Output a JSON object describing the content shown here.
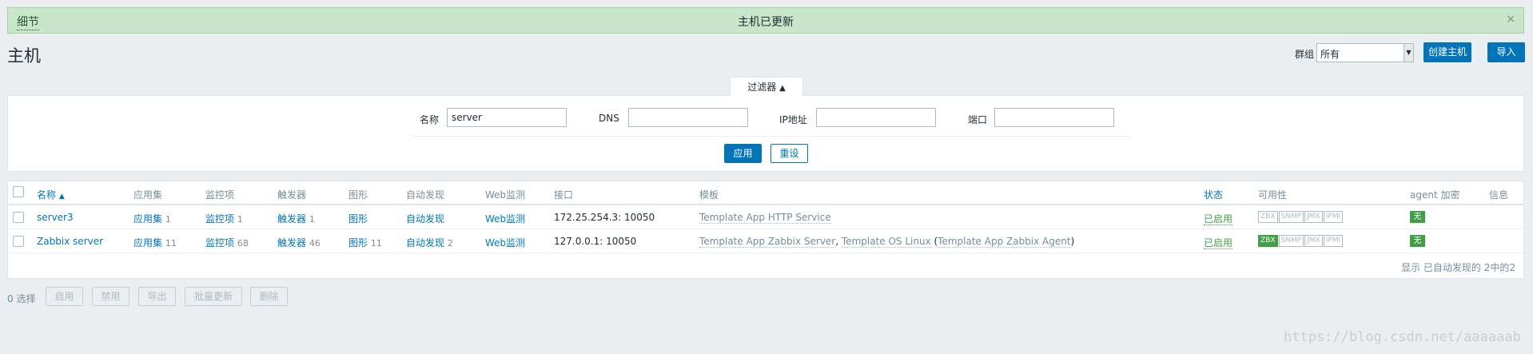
{
  "message": {
    "details": "细节",
    "text": "主机已更新",
    "close": "×"
  },
  "header": {
    "title": "主机",
    "group_label": "群组",
    "group_value": "所有",
    "create_button": "创建主机",
    "import_button": "导入"
  },
  "filter": {
    "tab_label": "过滤器",
    "tab_arrow": "▲",
    "name_label": "名称",
    "name_value": "server",
    "dns_label": "DNS",
    "dns_value": "",
    "ip_label": "IP地址",
    "ip_value": "",
    "port_label": "端口",
    "port_value": "",
    "apply": "应用",
    "reset": "重设"
  },
  "table": {
    "columns": {
      "name": "名称",
      "sort_arrow": "▲",
      "apps": "应用集",
      "items": "监控项",
      "triggers": "触发器",
      "graphs": "图形",
      "discovery": "自动发现",
      "web": "Web监测",
      "interface": "接口",
      "templates": "模板",
      "status": "状态",
      "availability": "可用性",
      "encryption": "agent 加密",
      "info": "信息"
    },
    "rows": [
      {
        "name": "server3",
        "apps": "应用集",
        "apps_count": "1",
        "items": "监控项",
        "items_count": "1",
        "triggers": "触发器",
        "triggers_count": "1",
        "graphs": "图形",
        "graphs_count": "",
        "discovery": "自动发现",
        "discovery_count": "",
        "web": "Web监测",
        "interface": "172.25.254.3: 10050",
        "template1": "Template App HTTP Service",
        "status": "已启用",
        "encryption": "无"
      },
      {
        "name": "Zabbix server",
        "apps": "应用集",
        "apps_count": "11",
        "items": "监控项",
        "items_count": "68",
        "triggers": "触发器",
        "triggers_count": "46",
        "graphs": "图形",
        "graphs_count": "11",
        "discovery": "自动发现",
        "discovery_count": "2",
        "web": "Web监测",
        "interface": "127.0.0.1: 10050",
        "template1": "Template App Zabbix Server",
        "template_sep1": ", ",
        "template2": "Template OS Linux",
        "template_open": " (",
        "template3": "Template App Zabbix Agent",
        "template_close": ")",
        "status": "已启用",
        "encryption": "无"
      }
    ],
    "badges": {
      "zbx": "ZBX",
      "snmp": "SNMP",
      "jmx": "JMX",
      "ipmi": "IPMI"
    },
    "footer": "显示 已自动发现的 2中的2"
  },
  "actions": {
    "selected": "0 选择",
    "enable": "启用",
    "disable": "禁用",
    "export": "导出",
    "mass_update": "批量更新",
    "delete": "删除"
  },
  "watermark": "https://blog.csdn.net/aaaaaab",
  "colors": {
    "accent": "#0275b8",
    "success": "#429e47",
    "message_bg": "#c8e6c9"
  }
}
